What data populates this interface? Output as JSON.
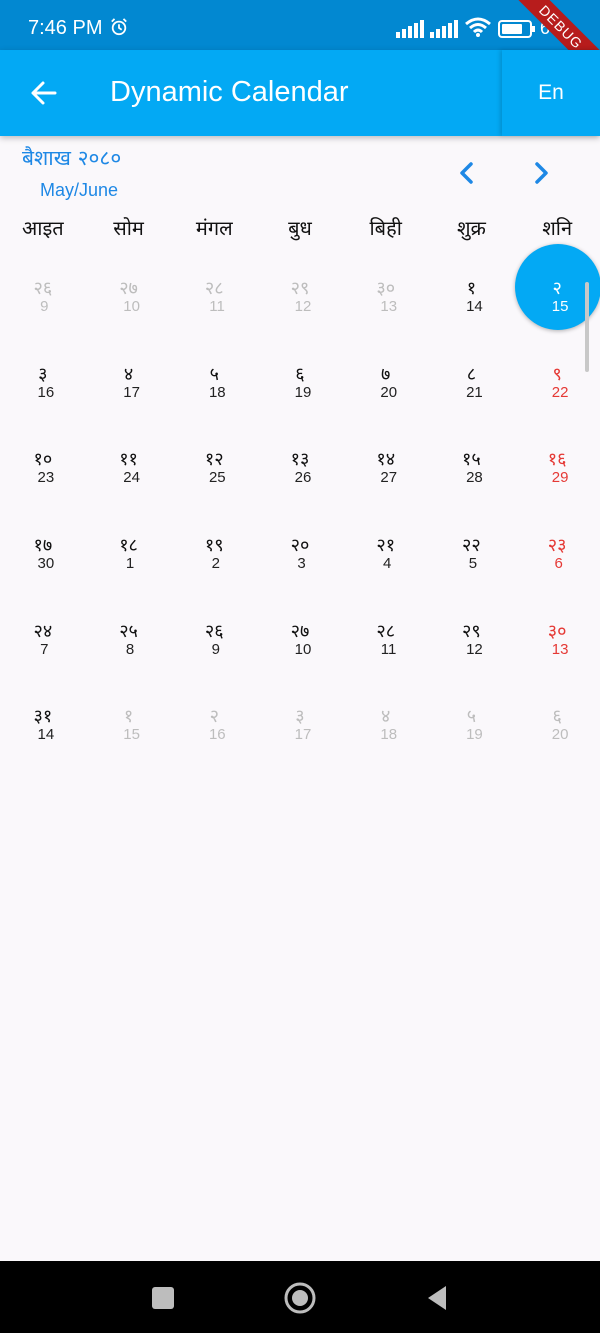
{
  "status_bar": {
    "time": "7:46 PM",
    "battery": "68",
    "debug_label": "DEBUG",
    "icons": [
      "alarm-icon",
      "signal-icon",
      "signal-icon",
      "wifi-icon",
      "battery-icon"
    ]
  },
  "app_bar": {
    "title": "Dynamic Calendar",
    "back_icon": "arrow-left-icon",
    "lang_label": "En"
  },
  "calendar": {
    "month_np": "बैशाख २०८०",
    "month_en": "May/June",
    "prev_icon": "chevron-left-icon",
    "next_icon": "chevron-right-icon",
    "weekdays": [
      "आइत",
      "सोम",
      "मंगल",
      "बुध",
      "बिही",
      "शुक्र",
      "शनि"
    ],
    "weeks": [
      [
        {
          "np": "२६",
          "en": "9",
          "muted": true
        },
        {
          "np": "२७",
          "en": "10",
          "muted": true
        },
        {
          "np": "२८",
          "en": "11",
          "muted": true
        },
        {
          "np": "२९",
          "en": "12",
          "muted": true
        },
        {
          "np": "३०",
          "en": "13",
          "muted": true
        },
        {
          "np": "१",
          "en": "14"
        },
        {
          "np": "२",
          "en": "15",
          "selected": true
        }
      ],
      [
        {
          "np": "३",
          "en": "16"
        },
        {
          "np": "४",
          "en": "17"
        },
        {
          "np": "५",
          "en": "18"
        },
        {
          "np": "६",
          "en": "19"
        },
        {
          "np": "७",
          "en": "20"
        },
        {
          "np": "८",
          "en": "21"
        },
        {
          "np": "९",
          "en": "22"
        }
      ],
      [
        {
          "np": "१०",
          "en": "23"
        },
        {
          "np": "११",
          "en": "24"
        },
        {
          "np": "१२",
          "en": "25"
        },
        {
          "np": "१३",
          "en": "26"
        },
        {
          "np": "१४",
          "en": "27"
        },
        {
          "np": "१५",
          "en": "28"
        },
        {
          "np": "१६",
          "en": "29"
        }
      ],
      [
        {
          "np": "१७",
          "en": "30"
        },
        {
          "np": "१८",
          "en": "1"
        },
        {
          "np": "१९",
          "en": "2"
        },
        {
          "np": "२०",
          "en": "3"
        },
        {
          "np": "२१",
          "en": "4"
        },
        {
          "np": "२२",
          "en": "5"
        },
        {
          "np": "२३",
          "en": "6"
        }
      ],
      [
        {
          "np": "२४",
          "en": "7"
        },
        {
          "np": "२५",
          "en": "8"
        },
        {
          "np": "२६",
          "en": "9"
        },
        {
          "np": "२७",
          "en": "10"
        },
        {
          "np": "२८",
          "en": "11"
        },
        {
          "np": "२९",
          "en": "12"
        },
        {
          "np": "३०",
          "en": "13"
        }
      ],
      [
        {
          "np": "३१",
          "en": "14"
        },
        {
          "np": "१",
          "en": "15",
          "muted": true
        },
        {
          "np": "२",
          "en": "16",
          "muted": true
        },
        {
          "np": "३",
          "en": "17",
          "muted": true
        },
        {
          "np": "४",
          "en": "18",
          "muted": true
        },
        {
          "np": "५",
          "en": "19",
          "muted": true
        },
        {
          "np": "६",
          "en": "20",
          "muted": true
        }
      ]
    ]
  },
  "nav_bar": {
    "buttons": [
      "recents-icon",
      "home-icon",
      "back-icon"
    ]
  },
  "colors": {
    "status_bar": "#0288d1",
    "app_bar": "#03a9f4",
    "accent_text": "#1e88e5",
    "saturday": "#e53935",
    "muted": "#bdbdbd"
  }
}
